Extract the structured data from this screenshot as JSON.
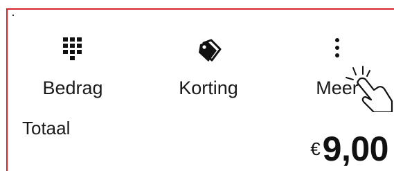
{
  "actions": [
    {
      "label": "Bedrag",
      "icon": "keypad-icon"
    },
    {
      "label": "Korting",
      "icon": "tag-icon"
    },
    {
      "label": "Meer",
      "icon": "more-vertical-icon"
    }
  ],
  "total": {
    "label": "Totaal",
    "currency": "€",
    "amount": "9,00"
  },
  "colors": {
    "frame_border": "#d8222a",
    "text": "#1a1a1a"
  },
  "overlay": {
    "icon": "tap-hand-icon"
  }
}
